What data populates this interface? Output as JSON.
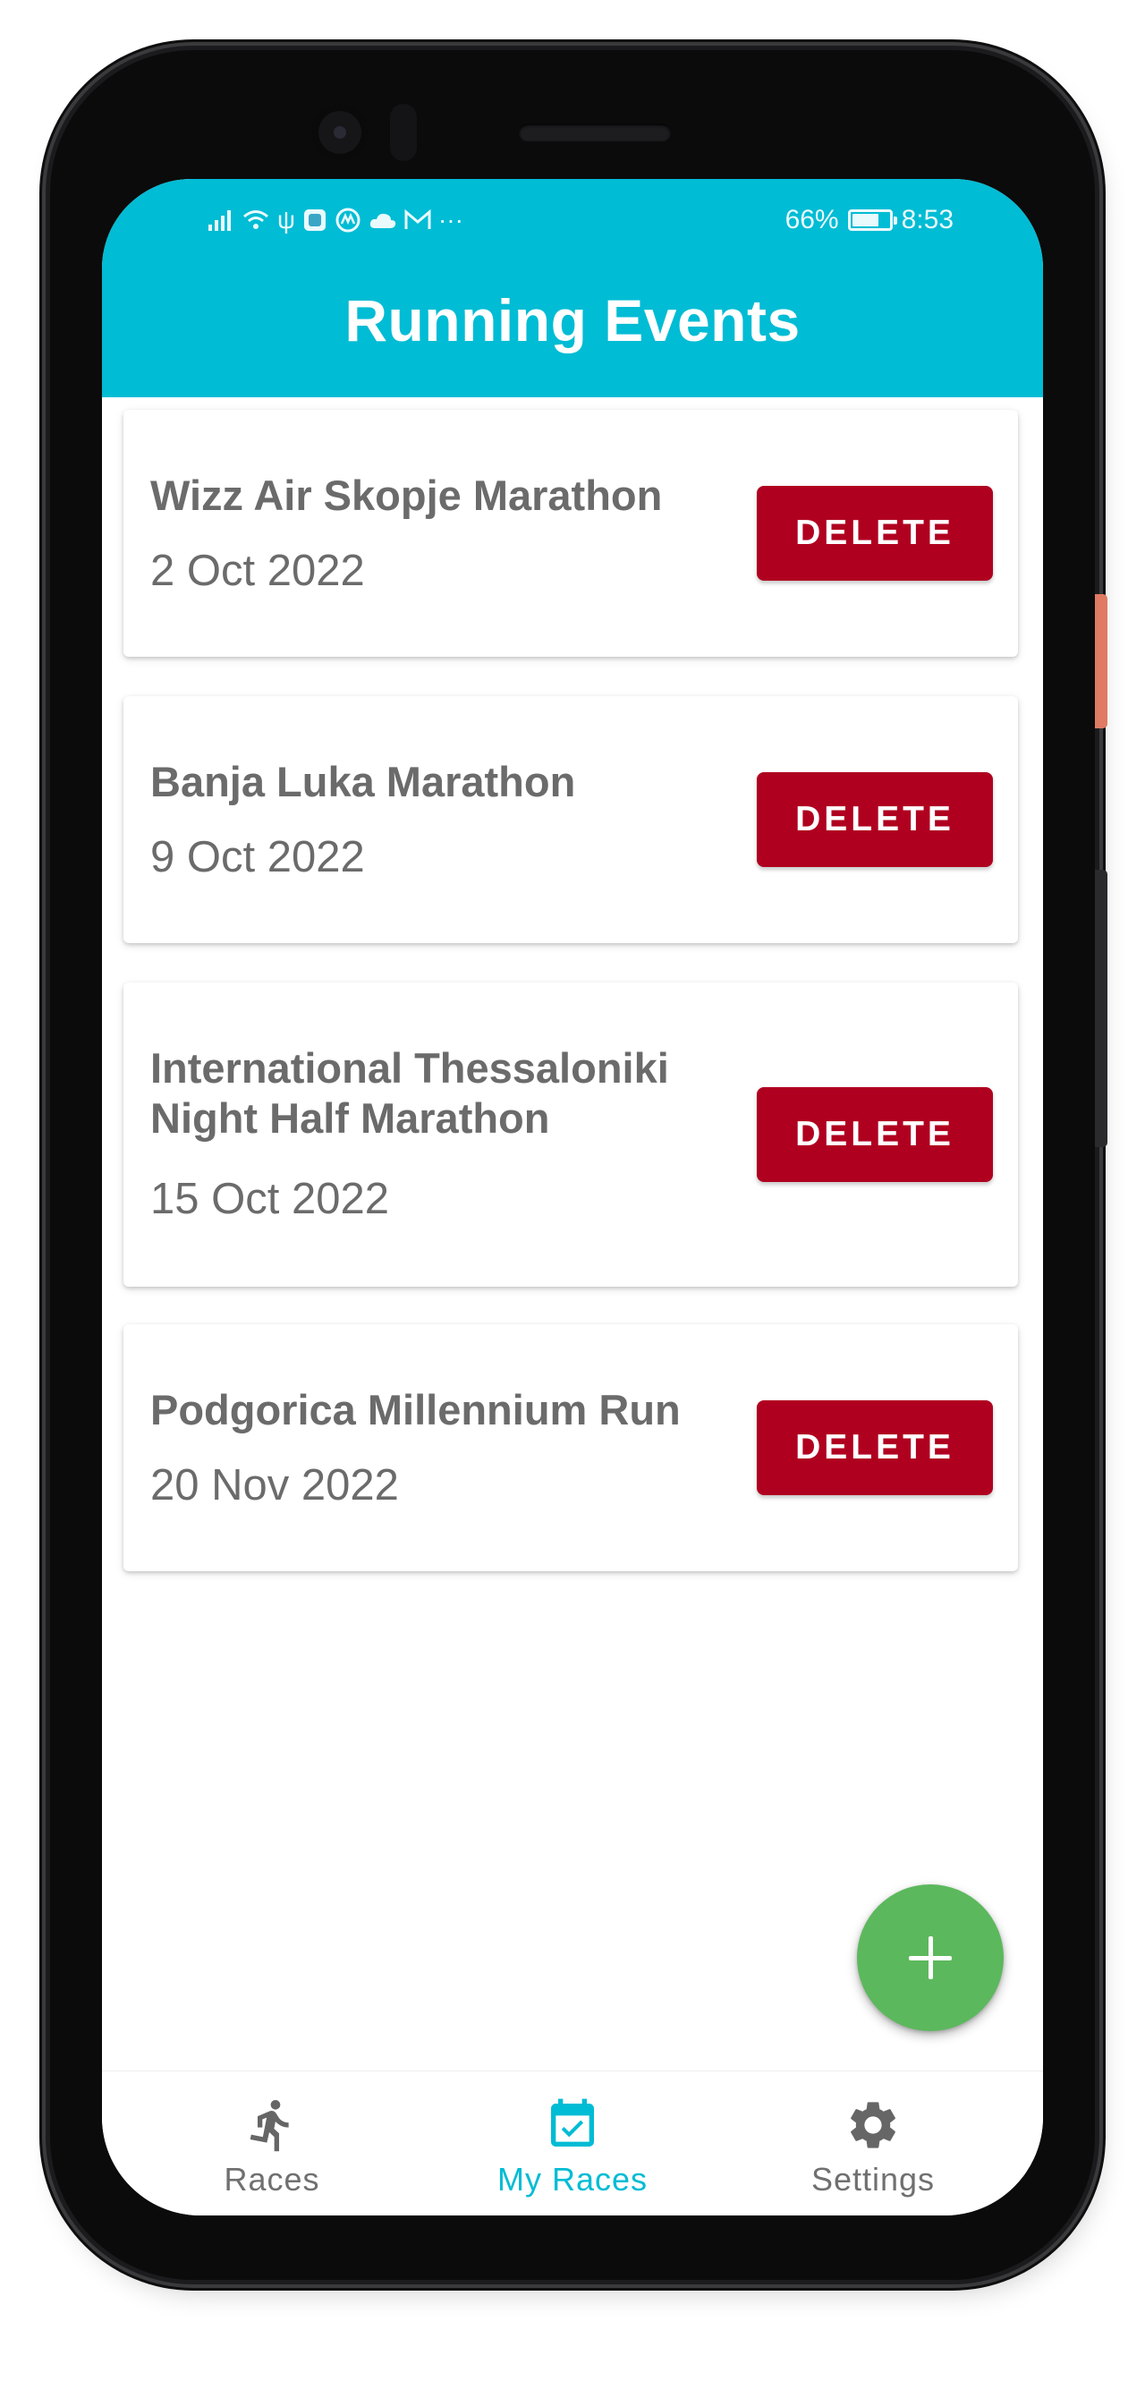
{
  "status_bar": {
    "battery": "66%",
    "time": "8:53",
    "icons": [
      "signal-icon",
      "wifi-icon",
      "usb-icon",
      "shield-app-icon",
      "circle-m-icon",
      "cloud-icon",
      "gmail-icon",
      "more-dots-icon"
    ]
  },
  "header": {
    "title": "Running Events"
  },
  "races": [
    {
      "name": "Wizz Air Skopje Marathon",
      "date": "2 Oct 2022",
      "action": "DELETE"
    },
    {
      "name": "Banja Luka Marathon",
      "date": "9 Oct 2022",
      "action": "DELETE"
    },
    {
      "name": "International Thessaloniki Night Half Marathon",
      "date": "15 Oct 2022",
      "action": "DELETE"
    },
    {
      "name": "Podgorica Millennium Run",
      "date": "20 Nov 2022",
      "action": "DELETE"
    }
  ],
  "fab": {
    "icon": "plus-icon"
  },
  "bottom_nav": {
    "items": [
      {
        "label": "Races",
        "icon": "runner-icon",
        "active": false
      },
      {
        "label": "My Races",
        "icon": "calendar-check-icon",
        "active": true
      },
      {
        "label": "Settings",
        "icon": "gear-icon",
        "active": false
      }
    ]
  },
  "colors": {
    "primary": "#00bcd4",
    "delete": "#b00020",
    "fab": "#5cb85c",
    "text": "#6b6b6b",
    "nav_inactive": "#707070"
  }
}
